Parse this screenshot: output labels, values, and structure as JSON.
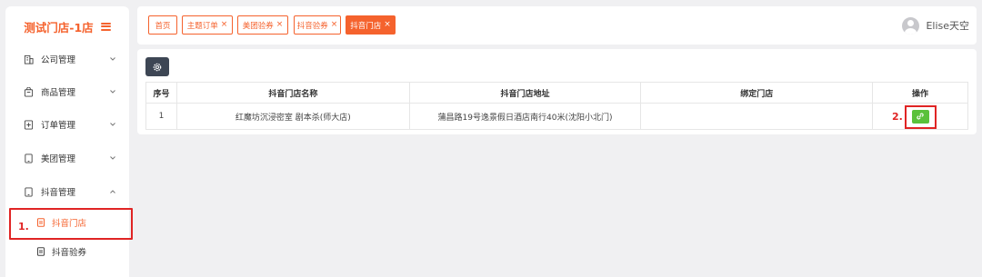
{
  "brand": {
    "title": "测试门店-1店"
  },
  "sidebar": {
    "items": [
      {
        "label": "公司管理",
        "icon": "building-icon"
      },
      {
        "label": "商品管理",
        "icon": "bag-icon"
      },
      {
        "label": "订单管理",
        "icon": "order-icon"
      },
      {
        "label": "美团管理",
        "icon": "tablet-icon"
      },
      {
        "label": "抖音管理",
        "icon": "tablet-icon"
      }
    ],
    "sub_items": [
      {
        "label": "抖音门店",
        "icon": "document-icon"
      },
      {
        "label": "抖音验券",
        "icon": "document-icon"
      }
    ]
  },
  "annotations": {
    "step1": "1.",
    "step2": "2."
  },
  "tabs": [
    {
      "label": "首页",
      "closable": false
    },
    {
      "label": "主题订单",
      "closable": true
    },
    {
      "label": "美团验券",
      "closable": true
    },
    {
      "label": "抖音验券",
      "closable": true
    },
    {
      "label": "抖音门店",
      "closable": true
    }
  ],
  "close_glyph": "×",
  "user": {
    "name": "Elise天空"
  },
  "table": {
    "headers": [
      "序号",
      "抖音门店名称",
      "抖音门店地址",
      "绑定门店",
      "操作"
    ],
    "rows": [
      {
        "index": "1",
        "name": "红魔坊沉浸密室 剧本杀(师大店)",
        "address": "蒲昌路19号逸景假日酒店南行40米(沈阳小北门)",
        "bound": ""
      }
    ]
  },
  "colors": {
    "accent": "#f5622d",
    "highlight": "#e02424",
    "link_button": "#5ac13a",
    "settings_button": "#3d4654"
  }
}
